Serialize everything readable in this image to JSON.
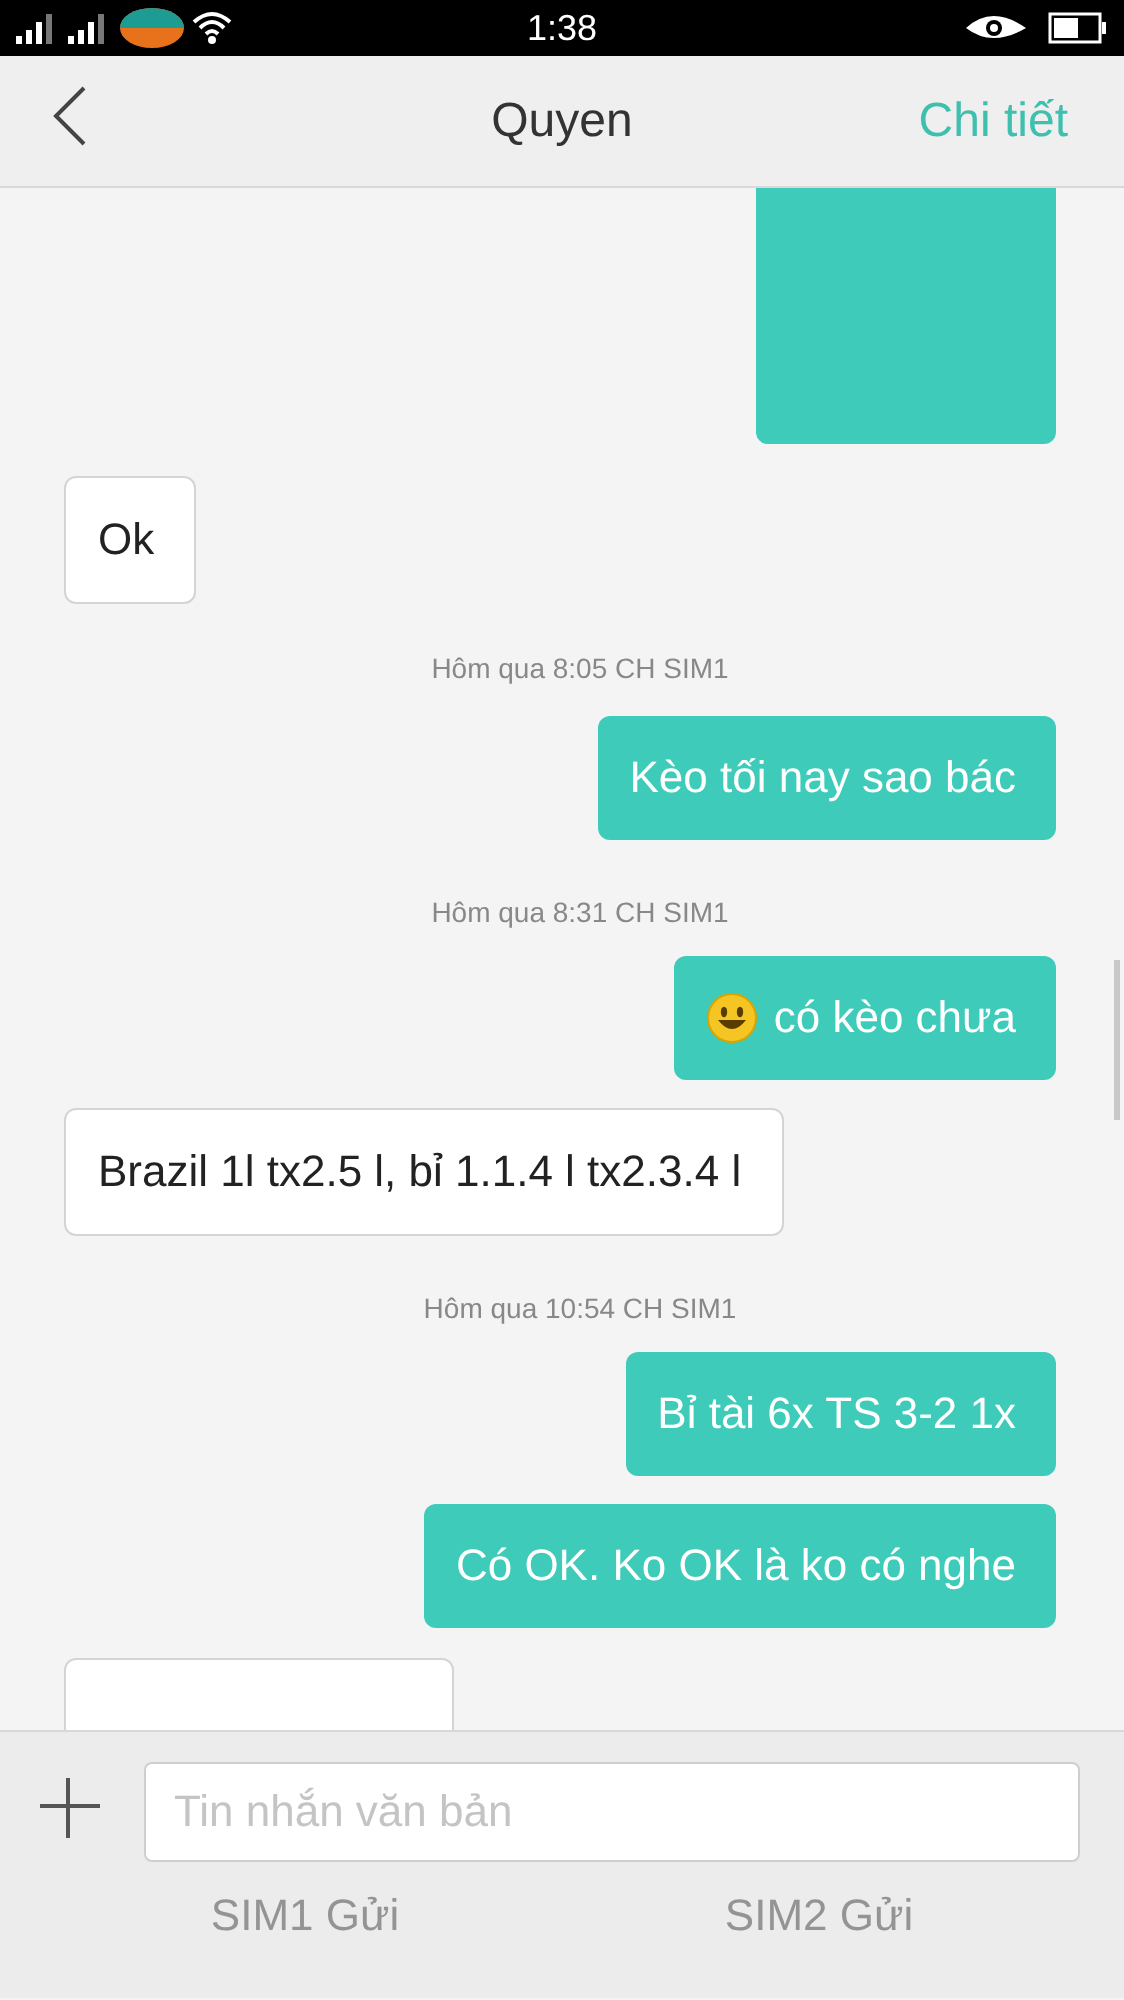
{
  "status_bar": {
    "time": "1:38"
  },
  "header": {
    "title": "Quyen",
    "action": "Chi tiết"
  },
  "messages": [
    {
      "kind": "out",
      "cut_off": true
    },
    {
      "kind": "in",
      "text": "Ok"
    },
    {
      "kind": "time",
      "text": "Hôm qua  8:05 CH  SIM1"
    },
    {
      "kind": "out",
      "text": "Kèo tối nay sao bác"
    },
    {
      "kind": "time",
      "text": "Hôm qua  8:31 CH  SIM1"
    },
    {
      "kind": "out",
      "text": "có kèo chưa",
      "emoji": true
    },
    {
      "kind": "in",
      "text": "Brazil 1l tx2.5 l, bỉ 1.1.4 l tx2.3.4 l"
    },
    {
      "kind": "time",
      "text": "Hôm qua  10:54 CH  SIM1"
    },
    {
      "kind": "out",
      "text": "Bỉ tài 6x TS 3-2 1x"
    },
    {
      "kind": "out",
      "text": "Có OK. Ko OK là ko có nghe"
    },
    {
      "kind": "in",
      "cut_off": true
    }
  ],
  "composer": {
    "placeholder": "Tin nhắn văn bản",
    "send_buttons": [
      {
        "label": "SIM1 Gửi",
        "disabled": true
      },
      {
        "label": "SIM2 Gửi",
        "disabled": true
      }
    ]
  }
}
